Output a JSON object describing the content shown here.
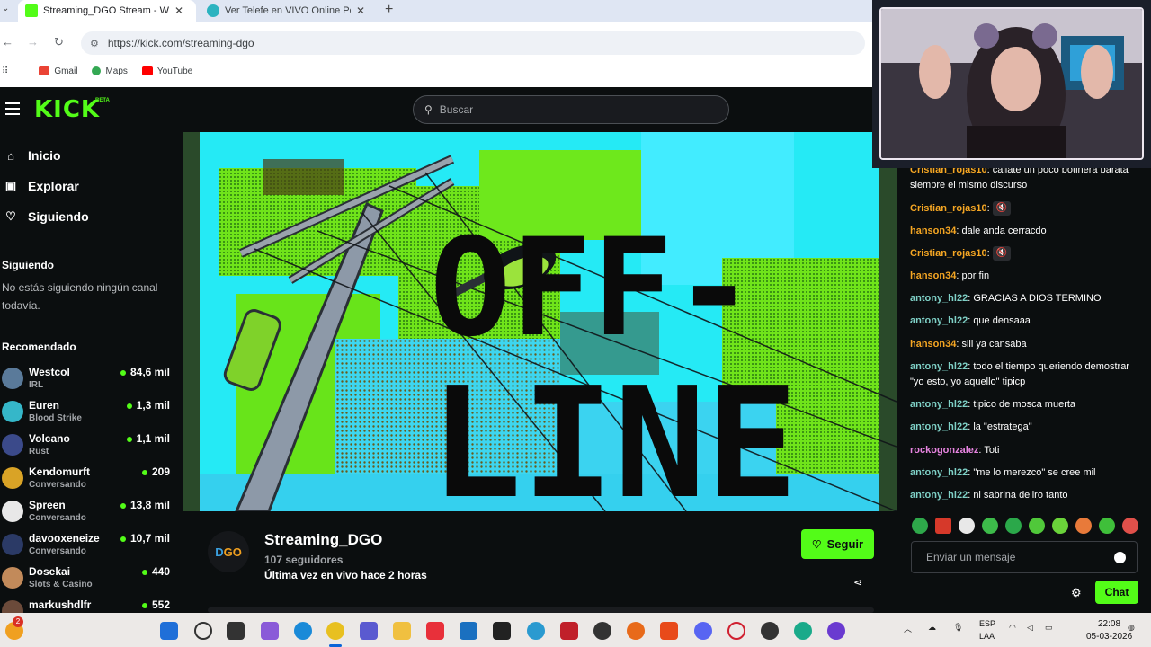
{
  "browser": {
    "tabs": [
      {
        "title": "Streaming_DGO Stream - Watch",
        "active": true
      },
      {
        "title": "Ver Telefe en VIVO Online Por in",
        "active": false
      }
    ],
    "url": "https://kick.com/streaming-dgo",
    "bookmarks": [
      "Gmail",
      "Maps",
      "YouTube"
    ]
  },
  "header": {
    "logo": "KICK",
    "logo_tag": "BETA",
    "search_placeholder": "Buscar"
  },
  "sidebar": {
    "nav": [
      {
        "label": "Inicio",
        "icon": "home-icon"
      },
      {
        "label": "Explorar",
        "icon": "browse-icon"
      },
      {
        "label": "Siguiendo",
        "icon": "heart-icon"
      }
    ],
    "following_heading": "Siguiendo",
    "following_empty": "No estás siguiendo ningún canal todavía.",
    "recommended_heading": "Recomendado",
    "recommended": [
      {
        "name": "Westcol",
        "category": "IRL",
        "viewers": "84,6 mil",
        "color": "#5a7a9a"
      },
      {
        "name": "Euren",
        "category": "Blood Strike",
        "viewers": "1,3 mil",
        "color": "#35b7c9"
      },
      {
        "name": "Volcano",
        "category": "Rust",
        "viewers": "1,1 mil",
        "color": "#3b4a8a"
      },
      {
        "name": "Kendomurft",
        "category": "Conversando",
        "viewers": "209",
        "color": "#d9a326"
      },
      {
        "name": "Spreen",
        "category": "Conversando",
        "viewers": "13,8 mil",
        "color": "#e8e8e8"
      },
      {
        "name": "davooxeneize",
        "category": "Conversando",
        "viewers": "10,7 mil",
        "color": "#2b3a66"
      },
      {
        "name": "Dosekai",
        "category": "Slots & Casino",
        "viewers": "440",
        "color": "#c28a5a"
      },
      {
        "name": "markushdlfr",
        "category": "",
        "viewers": "552",
        "color": "#6b4a3a"
      }
    ]
  },
  "video": {
    "offline_text_1": "OFF-",
    "offline_text_2": "LINE"
  },
  "channel": {
    "avatar_text_a": "D",
    "avatar_text_b": "GO",
    "name": "Streaming_DGO",
    "followers": "107 seguidores",
    "last_live": "Última vez en vivo hace 2 horas",
    "follow_label": "Seguir"
  },
  "chat": {
    "messages": [
      {
        "user": "Cristian_rojas10",
        "color": "#f5a623",
        "text": "callate un poco botinera barata siempre el mismo discurso",
        "muted": false
      },
      {
        "user": "Cristian_rojas10",
        "color": "#f5a623",
        "text": "",
        "muted": true
      },
      {
        "user": "hanson34",
        "color": "#f5a623",
        "text": "dale anda cerracdo",
        "muted": false
      },
      {
        "user": "Cristian_rojas10",
        "color": "#f5a623",
        "text": "",
        "muted": true
      },
      {
        "user": "hanson34",
        "color": "#f5a623",
        "text": "por fin",
        "muted": false
      },
      {
        "user": "antony_hl22",
        "color": "#7fd1c7",
        "text": "GRACIAS A DIOS TERMINO",
        "muted": false
      },
      {
        "user": "antony_hl22",
        "color": "#7fd1c7",
        "text": "que densaaa",
        "muted": false
      },
      {
        "user": "hanson34",
        "color": "#f5a623",
        "text": "sili ya cansaba",
        "muted": false
      },
      {
        "user": "antony_hl22",
        "color": "#7fd1c7",
        "text": "todo el tiempo queriendo demostrar \"yo esto, yo aquello\" tipicp",
        "muted": false
      },
      {
        "user": "antony_hl22",
        "color": "#7fd1c7",
        "text": "tipico de mosca muerta",
        "muted": false
      },
      {
        "user": "antony_hl22",
        "color": "#7fd1c7",
        "text": "la \"estratega\"",
        "muted": false
      },
      {
        "user": "rockogonzalez",
        "color": "#e784e0",
        "text": "Toti",
        "muted": false
      },
      {
        "user": "antony_hl22",
        "color": "#7fd1c7",
        "text": "\"me lo merezco\" se cree mil",
        "muted": false
      },
      {
        "user": "antony_hl22",
        "color": "#7fd1c7",
        "text": "ni sabrina deliro tanto",
        "muted": false
      }
    ],
    "input_placeholder": "Enviar un mensaje",
    "chat_button": "Chat"
  },
  "taskbar": {
    "lang_1": "ESP",
    "lang_2": "LAA",
    "time": "22:08",
    "date": "05-03-2026",
    "badge": "2"
  },
  "colors": {
    "accent": "#53fc18",
    "bg": "#0b0e0f"
  }
}
